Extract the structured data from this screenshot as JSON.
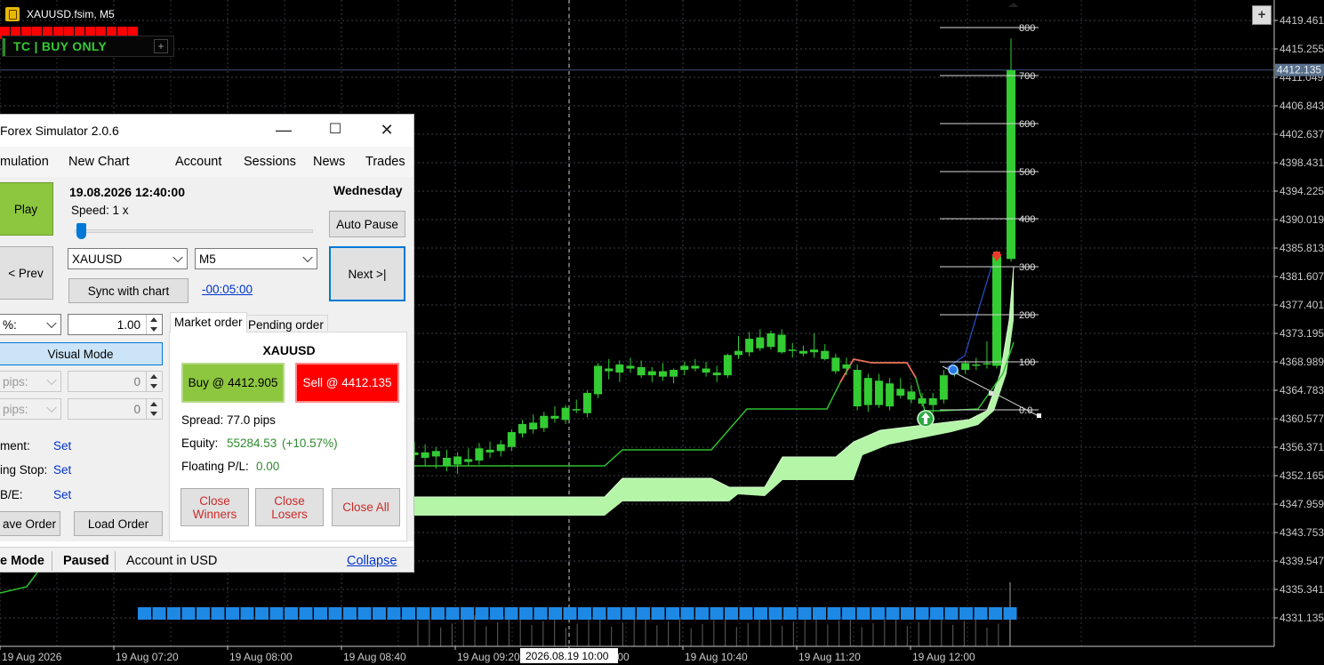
{
  "chart_window": {
    "title": "XAUUSD.fsim, M5",
    "tc_panel_label": "TC  |  BUY ONLY",
    "tc_panel_plus": "+",
    "corner_plus": "+",
    "current_price_label": "4412.135",
    "crosshair_time_label": "2026.08.19 10:00"
  },
  "chart_data": {
    "type": "candlestick",
    "symbol": "XAUUSD",
    "timeframe": "M5",
    "y_ticks": [
      "4419.461",
      "4415.255",
      "4411.049",
      "4406.843",
      "4402.637",
      "4398.431",
      "4394.225",
      "4390.019",
      "4385.813",
      "4381.607",
      "4377.401",
      "4373.195",
      "4368.989",
      "4364.783",
      "4360.577",
      "4356.371",
      "4352.165",
      "4347.959",
      "4343.753",
      "4339.547",
      "4335.341",
      "4331.135"
    ],
    "x_ticks": [
      "19 Aug 2026",
      "19 Aug 07:20",
      "19 Aug 08:00",
      "19 Aug 08:40",
      "19 Aug 09:20",
      ":00",
      "19 Aug 10:40",
      "19 Aug 11:20",
      "19 Aug 12:00"
    ],
    "fib_levels": [
      "800",
      "700",
      "600",
      "500",
      "400",
      "300",
      "200",
      "100",
      "0.0"
    ],
    "candles": [
      {
        "o": 4355.6,
        "h": 4357.2,
        "l": 4354.4,
        "c": 4355.2
      },
      {
        "o": 4355.6,
        "h": 4356.8,
        "l": 4353.6,
        "c": 4354.8
      },
      {
        "o": 4355.0,
        "h": 4356.4,
        "l": 4353.2,
        "c": 4355.8
      },
      {
        "o": 4354.8,
        "h": 4356.0,
        "l": 4352.8,
        "c": 4353.6
      },
      {
        "o": 4353.8,
        "h": 4355.6,
        "l": 4352.4,
        "c": 4355.0
      },
      {
        "o": 4354.6,
        "h": 4356.2,
        "l": 4353.6,
        "c": 4354.2
      },
      {
        "o": 4354.4,
        "h": 4357.0,
        "l": 4353.8,
        "c": 4356.2
      },
      {
        "o": 4356.0,
        "h": 4357.2,
        "l": 4354.8,
        "c": 4355.6
      },
      {
        "o": 4355.8,
        "h": 4357.4,
        "l": 4355.0,
        "c": 4356.8
      },
      {
        "o": 4356.4,
        "h": 4359.0,
        "l": 4355.8,
        "c": 4358.6
      },
      {
        "o": 4358.4,
        "h": 4360.4,
        "l": 4357.8,
        "c": 4359.8
      },
      {
        "o": 4360.0,
        "h": 4361.2,
        "l": 4358.4,
        "c": 4359.0
      },
      {
        "o": 4359.2,
        "h": 4361.6,
        "l": 4358.6,
        "c": 4361.0
      },
      {
        "o": 4361.0,
        "h": 4362.4,
        "l": 4360.0,
        "c": 4360.6
      },
      {
        "o": 4360.4,
        "h": 4362.6,
        "l": 4359.8,
        "c": 4362.2
      },
      {
        "o": 4362.0,
        "h": 4363.4,
        "l": 4361.4,
        "c": 4361.8
      },
      {
        "o": 4361.4,
        "h": 4364.8,
        "l": 4360.8,
        "c": 4364.4
      },
      {
        "o": 4364.2,
        "h": 4368.8,
        "l": 4363.6,
        "c": 4368.4
      },
      {
        "o": 4368.0,
        "h": 4369.4,
        "l": 4366.4,
        "c": 4367.6
      },
      {
        "o": 4367.4,
        "h": 4369.2,
        "l": 4366.0,
        "c": 4368.6
      },
      {
        "o": 4368.4,
        "h": 4369.6,
        "l": 4367.4,
        "c": 4368.0
      },
      {
        "o": 4368.2,
        "h": 4369.2,
        "l": 4366.6,
        "c": 4367.0
      },
      {
        "o": 4367.0,
        "h": 4368.2,
        "l": 4366.0,
        "c": 4367.6
      },
      {
        "o": 4367.6,
        "h": 4368.8,
        "l": 4366.2,
        "c": 4366.8
      },
      {
        "o": 4366.8,
        "h": 4368.0,
        "l": 4365.8,
        "c": 4367.8
      },
      {
        "o": 4367.8,
        "h": 4369.0,
        "l": 4367.0,
        "c": 4368.4
      },
      {
        "o": 4368.4,
        "h": 4369.4,
        "l": 4367.6,
        "c": 4368.0
      },
      {
        "o": 4368.0,
        "h": 4369.0,
        "l": 4366.8,
        "c": 4367.4
      },
      {
        "o": 4367.4,
        "h": 4368.4,
        "l": 4366.0,
        "c": 4367.0
      },
      {
        "o": 4367.0,
        "h": 4370.2,
        "l": 4366.6,
        "c": 4370.0
      },
      {
        "o": 4370.0,
        "h": 4372.8,
        "l": 4369.4,
        "c": 4370.6
      },
      {
        "o": 4370.4,
        "h": 4373.4,
        "l": 4369.8,
        "c": 4372.4
      },
      {
        "o": 4372.6,
        "h": 4373.8,
        "l": 4370.6,
        "c": 4371.0
      },
      {
        "o": 4371.2,
        "h": 4373.6,
        "l": 4370.8,
        "c": 4373.2
      },
      {
        "o": 4373.0,
        "h": 4373.8,
        "l": 4370.2,
        "c": 4370.4
      },
      {
        "o": 4370.8,
        "h": 4371.8,
        "l": 4369.6,
        "c": 4370.6
      },
      {
        "o": 4370.6,
        "h": 4371.4,
        "l": 4369.8,
        "c": 4370.2
      },
      {
        "o": 4370.4,
        "h": 4373.2,
        "l": 4369.6,
        "c": 4370.8
      },
      {
        "o": 4370.6,
        "h": 4371.6,
        "l": 4369.2,
        "c": 4369.4
      },
      {
        "o": 4369.6,
        "h": 4370.2,
        "l": 4367.2,
        "c": 4367.6
      },
      {
        "o": 4368.6,
        "h": 4369.6,
        "l": 4367.0,
        "c": 4368.0
      },
      {
        "o": 4367.8,
        "h": 4368.6,
        "l": 4361.8,
        "c": 4362.4
      },
      {
        "o": 4362.6,
        "h": 4367.2,
        "l": 4361.6,
        "c": 4366.6
      },
      {
        "o": 4366.2,
        "h": 4367.2,
        "l": 4362.2,
        "c": 4362.6
      },
      {
        "o": 4362.4,
        "h": 4366.6,
        "l": 4361.8,
        "c": 4365.8
      },
      {
        "o": 4365.0,
        "h": 4366.6,
        "l": 4363.6,
        "c": 4364.0
      },
      {
        "o": 4364.6,
        "h": 4365.6,
        "l": 4362.8,
        "c": 4363.4
      },
      {
        "o": 4363.6,
        "h": 4364.4,
        "l": 4362.4,
        "c": 4362.8
      },
      {
        "o": 4362.6,
        "h": 4364.4,
        "l": 4361.4,
        "c": 4363.6
      },
      {
        "o": 4363.4,
        "h": 4367.8,
        "l": 4362.8,
        "c": 4367.0
      },
      {
        "o": 4367.2,
        "h": 4368.6,
        "l": 4366.8,
        "c": 4367.8
      },
      {
        "o": 4367.8,
        "h": 4369.2,
        "l": 4367.2,
        "c": 4368.8
      },
      {
        "o": 4368.4,
        "h": 4369.6,
        "l": 4367.8,
        "c": 4368.6
      },
      {
        "o": 4368.6,
        "h": 4372.0,
        "l": 4368.0,
        "c": 4368.8
      },
      {
        "o": 4369.0,
        "h": 4370.2,
        "l": 4368.4,
        "c": 4369.6
      },
      {
        "o": 4368.4,
        "h": 4385.4,
        "l": 4368.0,
        "c": 4384.6
      },
      {
        "o": 4384.2,
        "h": 4416.8,
        "l": 4383.8,
        "c": 4412.1
      }
    ]
  },
  "simulator": {
    "title": "Forex Simulator 2.0.6",
    "window_buttons": {
      "minimize": "—",
      "maximize": "☐",
      "close": "✕"
    },
    "menu": [
      "mulation",
      "New Chart",
      "Account",
      "Sessions",
      "News",
      "Trades"
    ],
    "play_label": "Play",
    "datetime": "19.08.2026 12:40:00",
    "weekday": "Wednesday",
    "speed_label": "Speed: 1 x",
    "speed_value": 1,
    "auto_pause_label": "Auto Pause",
    "prev_label": "< Prev",
    "symbol_value": "XAUUSD",
    "timeframe_value": "M5",
    "next_label": "Next >|",
    "sync_label": "Sync with chart",
    "time_offset_link": "-00:05:00",
    "risk_mode_value": "%:",
    "risk_value": "1.00",
    "visual_mode_label": "Visual Mode",
    "sl_mode_value": "pips:",
    "sl_value": "0",
    "tp_mode_value": "pips:",
    "tp_value": "0",
    "management_label": "ment:",
    "trailing_stop_label": "ing Stop:",
    "be_label": "B/E:",
    "set_label": "Set",
    "save_order_label": "ave Order",
    "load_order_label": "Load Order",
    "tabs": [
      "Market order",
      "Pending order"
    ],
    "order_symbol": "XAUUSD",
    "buy_label": "Buy @ 4412.905",
    "sell_label": "Sell @ 4412.135",
    "spread_label": "Spread: 77.0 pips",
    "equity_label": "Equity:",
    "equity_value": "55284.53",
    "equity_change": "(+10.57%)",
    "floating_label": "Floating P/L:",
    "floating_value": "0.00",
    "close_winners_line1": "Close",
    "close_winners_line2": "Winners",
    "close_losers_line1": "Close",
    "close_losers_line2": "Losers",
    "close_all_label": "Close All",
    "status_mode": "e Mode",
    "status_paused": "Paused",
    "status_account": "Account in USD",
    "collapse_label": "Collapse"
  }
}
